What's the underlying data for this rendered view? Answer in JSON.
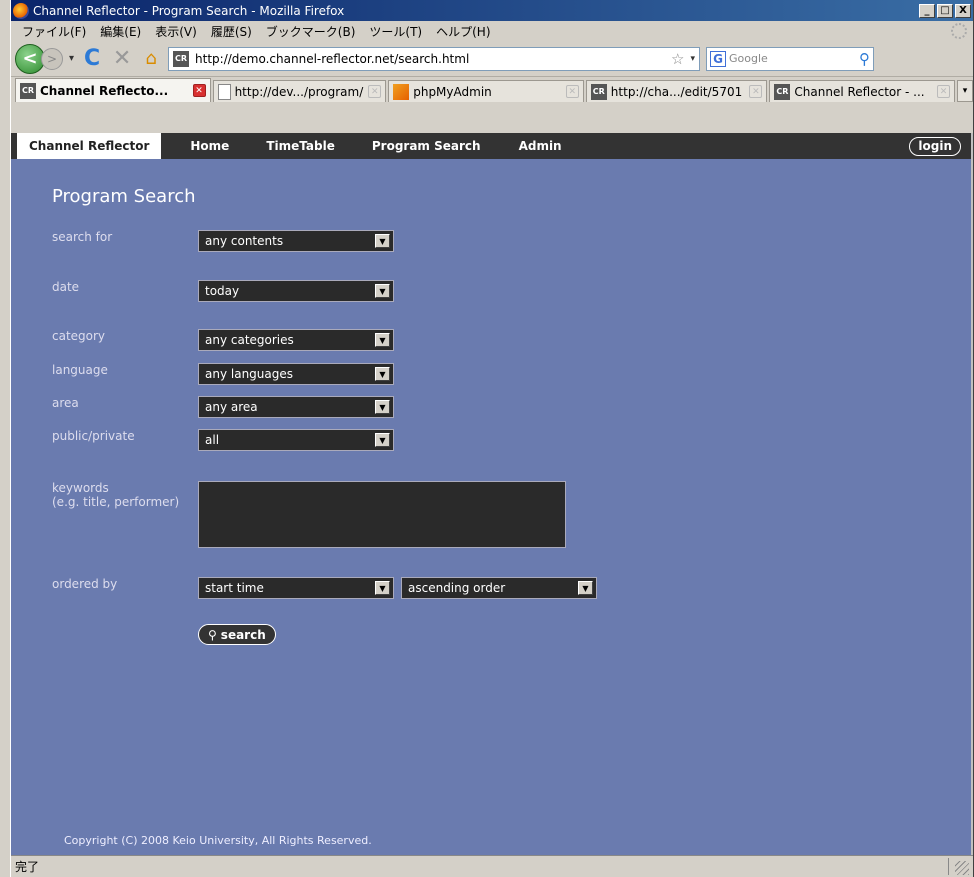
{
  "window": {
    "title": "Channel Reflector - Program Search - Mozilla Firefox",
    "controls": [
      "_",
      "□",
      "X"
    ]
  },
  "menubar": {
    "items": [
      "ファイル(F)",
      "編集(E)",
      "表示(V)",
      "履歴(S)",
      "ブックマーク(B)",
      "ツール(T)",
      "ヘルプ(H)"
    ]
  },
  "toolbar": {
    "back_glyph": "<",
    "forward_glyph": ">",
    "dropdown_glyph": "▾",
    "reload_glyph": "C",
    "stop_glyph": "✕",
    "home_glyph": "⌂",
    "site_icon": "CR",
    "url": "http://demo.channel-reflector.net/search.html",
    "bookmark_star": "☆",
    "url_dropdown": "▾",
    "search_engine_icon": "G",
    "search_placeholder": "Google",
    "search_glyph": "⚲"
  },
  "tabs": [
    {
      "label": "Channel Reflecto...",
      "icon": "CR",
      "active": true
    },
    {
      "label": "http://dev.../program/",
      "icon": "page",
      "active": false
    },
    {
      "label": "phpMyAdmin",
      "icon": "pma",
      "active": false
    },
    {
      "label": "http://cha.../edit/5701",
      "icon": "CR",
      "active": false
    },
    {
      "label": "Channel Reflector - ...",
      "icon": "CR",
      "active": false
    }
  ],
  "tab_close_glyph": "✕",
  "tab_more_glyph": "▾",
  "site": {
    "brand": "Channel Reflector",
    "nav": [
      "Home",
      "TimeTable",
      "Program Search",
      "Admin"
    ],
    "login": "login"
  },
  "form": {
    "title": "Program Search",
    "search_for": {
      "label": "search for",
      "value": "any contents"
    },
    "date": {
      "label": "date",
      "value": "today"
    },
    "category": {
      "label": "category",
      "value": "any categories"
    },
    "language": {
      "label": "language",
      "value": "any languages"
    },
    "area": {
      "label": "area",
      "value": "any area"
    },
    "public_private": {
      "label": "public/private",
      "value": "all"
    },
    "keywords": {
      "label": "keywords",
      "hint": "(e.g. title, performer)",
      "value": ""
    },
    "ordered_by": {
      "label": "ordered by",
      "field": "start time",
      "direction": "ascending order"
    },
    "select_arrow": "▼",
    "search_button": "search",
    "search_glyph": "⚲"
  },
  "footer": {
    "copyright": "Copyright (C) 2008 Keio University, All Rights Reserved."
  },
  "status": {
    "text": "完了"
  }
}
